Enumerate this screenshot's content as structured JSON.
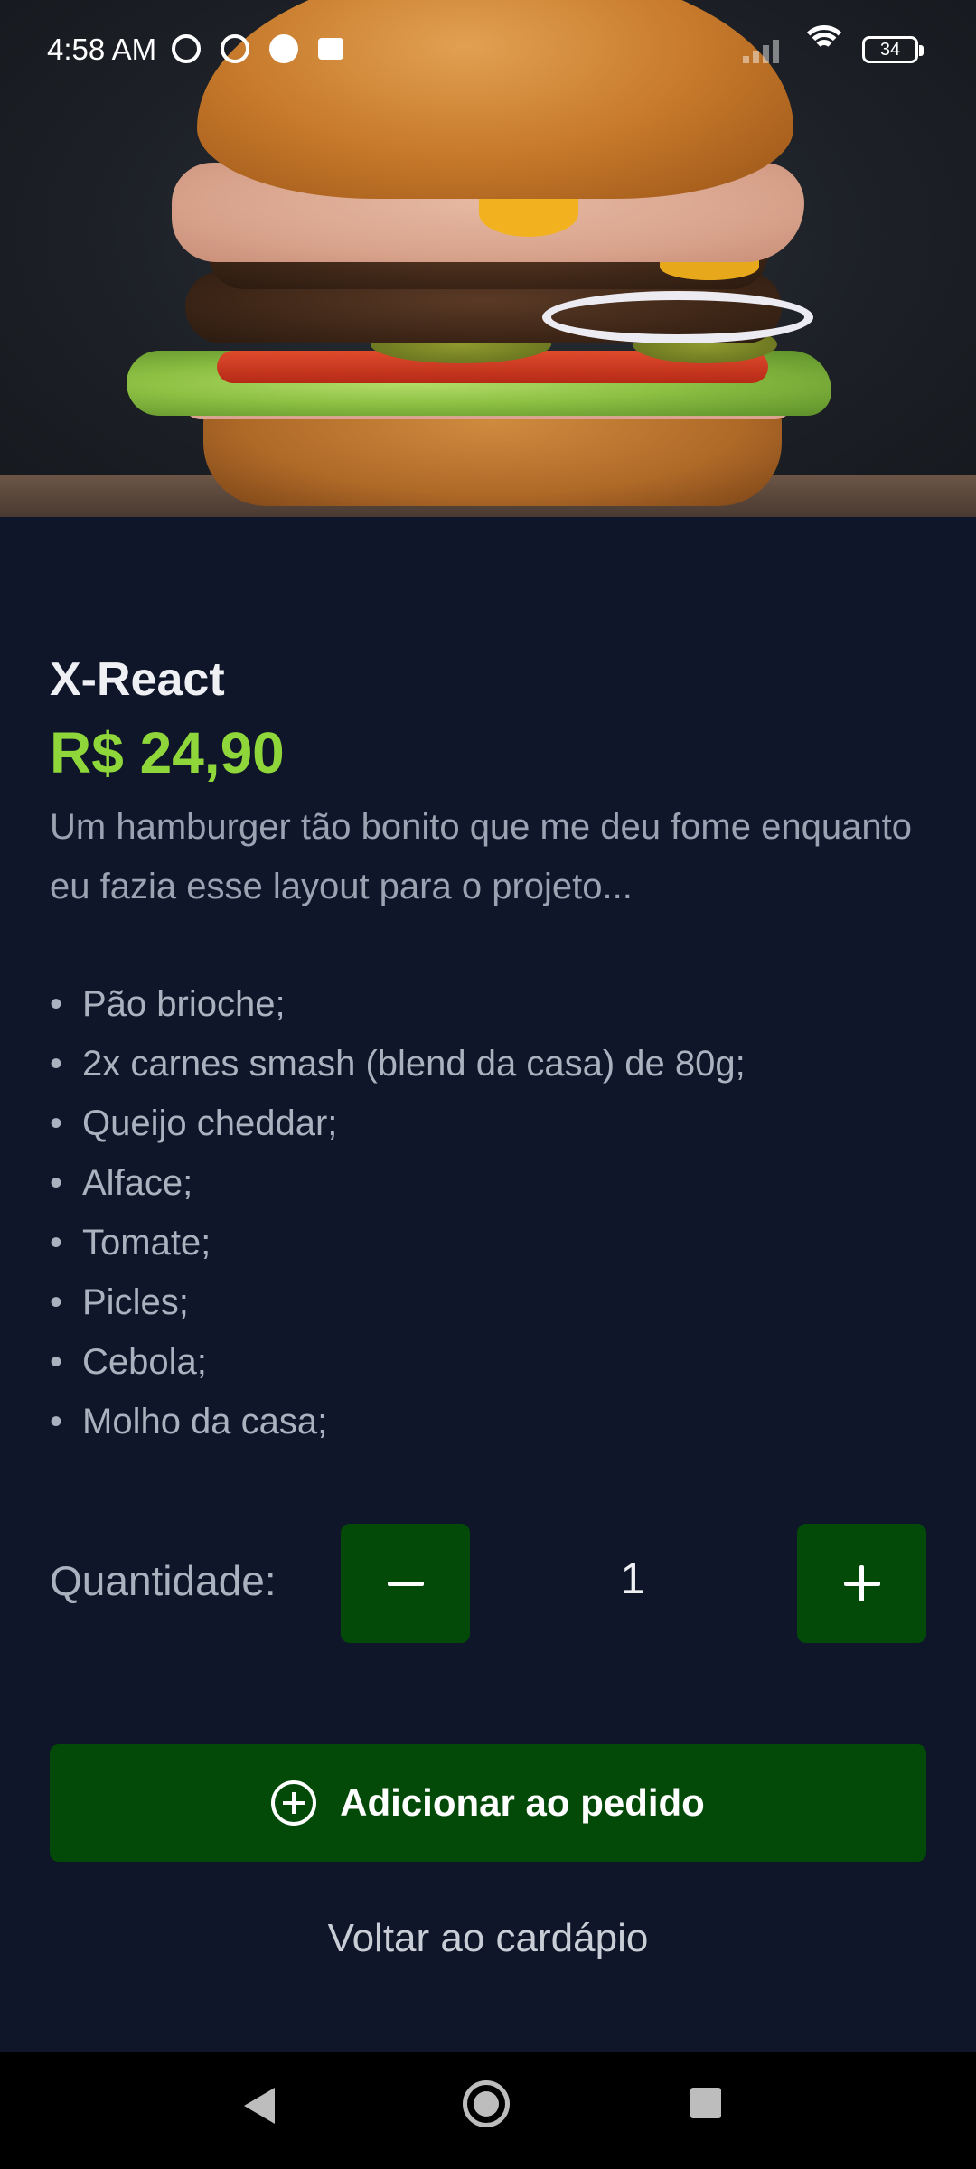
{
  "status_bar": {
    "time": "4:58 AM",
    "battery": "34"
  },
  "product": {
    "name": "X-React",
    "price": "R$ 24,90",
    "description": "Um hamburger tão bonito que me deu fome enquanto eu fazia esse layout para o projeto...",
    "ingredients": [
      "Pão brioche;",
      "2x carnes smash (blend da casa) de 80g;",
      "Queijo cheddar;",
      "Alface;",
      "Tomate;",
      "Picles;",
      "Cebola;",
      "Molho da casa;"
    ]
  },
  "quantity": {
    "label": "Quantidade:",
    "value": "1"
  },
  "actions": {
    "add_label": "Adicionar ao pedido",
    "back_label": "Voltar ao cardápio"
  },
  "colors": {
    "background": "#0f1629",
    "price": "#8fd63a",
    "button": "#034a08"
  }
}
